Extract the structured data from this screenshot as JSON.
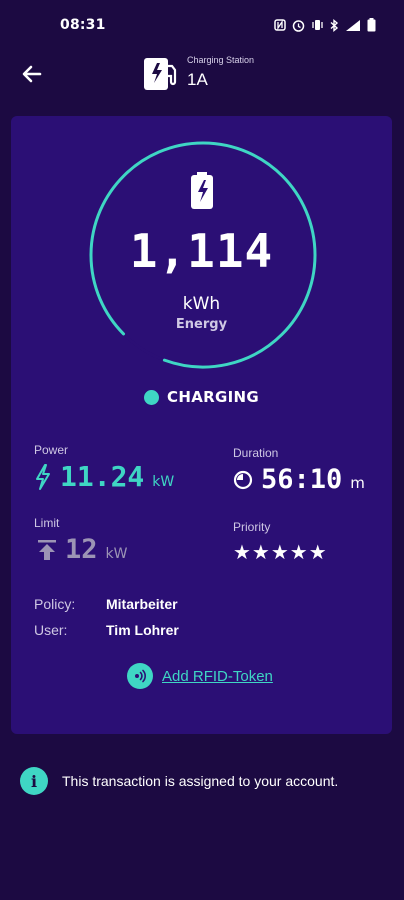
{
  "status_bar": {
    "time": "08:31",
    "icons": [
      "nfc-icon",
      "alarm-icon",
      "vibrate-icon",
      "bluetooth-icon",
      "signal-icon",
      "battery-icon"
    ]
  },
  "header": {
    "caption": "Charging Station",
    "station_name": "1A",
    "back_icon": "arrow-left-icon",
    "station_icon": "ev-charger-icon"
  },
  "energy": {
    "value": "1,114",
    "unit": "kWh",
    "label": "Energy",
    "ring_fill_fraction": 0.93
  },
  "charging_status": {
    "text": "CHARGING",
    "color": "#3fd6c4"
  },
  "stats": {
    "power": {
      "label": "Power",
      "value": "11.24",
      "unit": "kW",
      "icon": "bolt-icon"
    },
    "duration": {
      "label": "Duration",
      "value": "56:10",
      "unit": "m",
      "icon": "timer-icon"
    },
    "limit": {
      "label": "Limit",
      "value": "12",
      "unit": "kW",
      "icon": "upload-limit-icon"
    },
    "priority": {
      "label": "Priority",
      "stars": "★★★★★",
      "rating": 5,
      "max": 5
    }
  },
  "details": {
    "policy_label": "Policy:",
    "policy_value": "Mitarbeiter",
    "user_label": "User:",
    "user_value": "Tim Lohrer"
  },
  "rfid": {
    "label": "Add RFID-Token",
    "icon": "nfc-icon"
  },
  "notice": {
    "text": "This transaction is assigned to your account.",
    "icon": "info-icon"
  },
  "colors": {
    "background": "#1c0a42",
    "card": "#2b0f75",
    "accent": "#3fd6c4",
    "muted": "#9c94b5"
  }
}
